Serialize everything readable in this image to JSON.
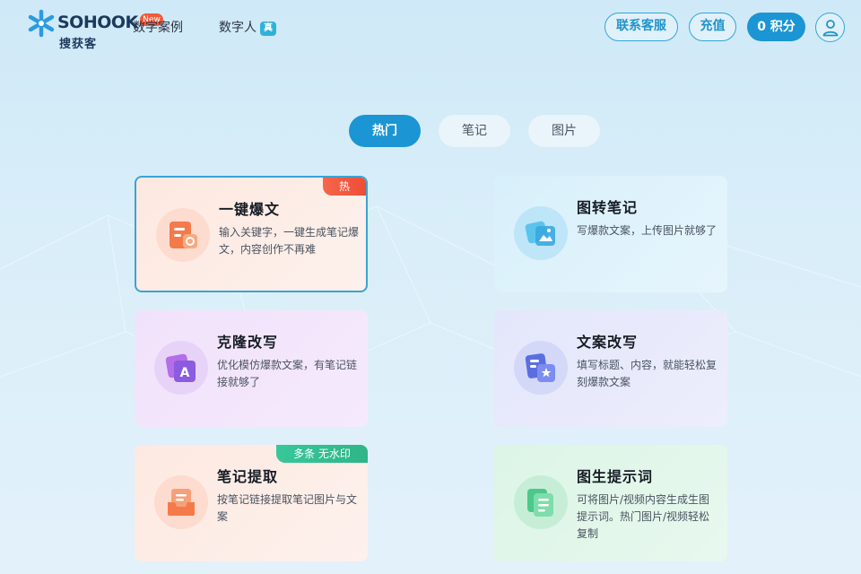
{
  "header": {
    "logo_text": "SOHOOK",
    "logo_sub": "搜获客",
    "nav": [
      {
        "label": "数字案例",
        "badge": "New"
      },
      {
        "label": "数字人",
        "badge": "真"
      }
    ],
    "contact_label": "联系客服",
    "recharge_label": "充值",
    "points_label": "0 积分"
  },
  "tabs": [
    {
      "label": "热门",
      "active": true
    },
    {
      "label": "笔记",
      "active": false
    },
    {
      "label": "图片",
      "active": false
    }
  ],
  "cards": [
    {
      "title": "一键爆文",
      "desc": "输入关键字，一键生成笔记爆文，内容创作不再难",
      "tag": "热",
      "icon": "article-icon",
      "selected": true
    },
    {
      "title": "图转笔记",
      "desc": "写爆款文案，上传图片就够了",
      "tag": "",
      "icon": "image-to-note-icon",
      "selected": false
    },
    {
      "title": "克隆改写",
      "desc": "优化模仿爆款文案，有笔记链接就够了",
      "tag": "",
      "icon": "clone-rewrite-icon",
      "selected": false
    },
    {
      "title": "文案改写",
      "desc": "填写标题、内容，就能轻松复刻爆款文案",
      "tag": "",
      "icon": "copy-rewrite-icon",
      "selected": false
    },
    {
      "title": "笔记提取",
      "desc": "按笔记链接提取笔记图片与文案",
      "tag": "多条 无水印",
      "icon": "note-extract-icon",
      "selected": false
    },
    {
      "title": "图生提示词",
      "desc": "可将图片/视频内容生成生图提示词。热门图片/视频轻松复制",
      "tag": "",
      "icon": "image-prompt-icon",
      "selected": false
    }
  ],
  "colors": {
    "accent": "#1b95d3",
    "hot_tag": "#f05a3c",
    "green_tag": "#3cc49a"
  }
}
